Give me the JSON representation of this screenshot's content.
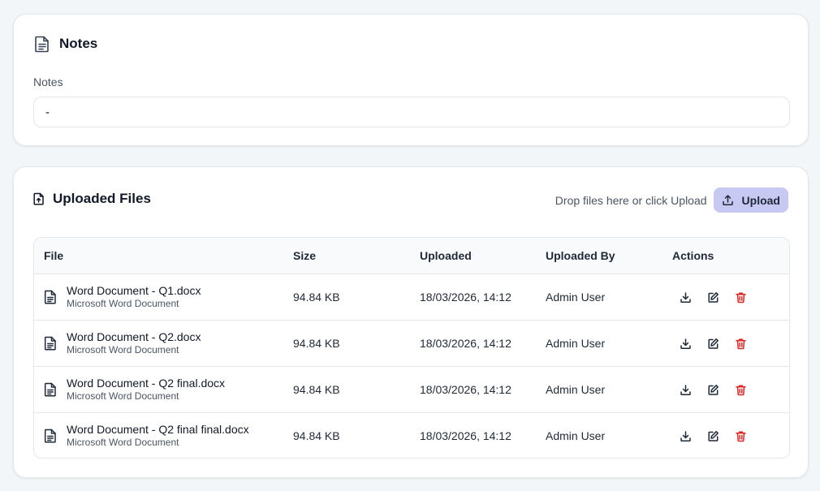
{
  "notes_card": {
    "title": "Notes",
    "field_label": "Notes",
    "field_value": "-"
  },
  "files_card": {
    "title": "Uploaded Files",
    "drop_hint": "Drop files here or click Upload",
    "upload_label": "Upload",
    "upload_button_color": "#c7c9f3",
    "delete_icon_color": "#dc2626",
    "columns": [
      "File",
      "Size",
      "Uploaded",
      "Uploaded By",
      "Actions"
    ],
    "rows": [
      {
        "name": "Word Document - Q1.docx",
        "type": "Microsoft Word Document",
        "size": "94.84 KB",
        "uploaded": "18/03/2026, 14:12",
        "by": "Admin User"
      },
      {
        "name": "Word Document - Q2.docx",
        "type": "Microsoft Word Document",
        "size": "94.84 KB",
        "uploaded": "18/03/2026, 14:12",
        "by": "Admin User"
      },
      {
        "name": "Word Document - Q2 final.docx",
        "type": "Microsoft Word Document",
        "size": "94.84 KB",
        "uploaded": "18/03/2026, 14:12",
        "by": "Admin User"
      },
      {
        "name": "Word Document - Q2 final final.docx",
        "type": "Microsoft Word Document",
        "size": "94.84 KB",
        "uploaded": "18/03/2026, 14:12",
        "by": "Admin User"
      }
    ]
  }
}
